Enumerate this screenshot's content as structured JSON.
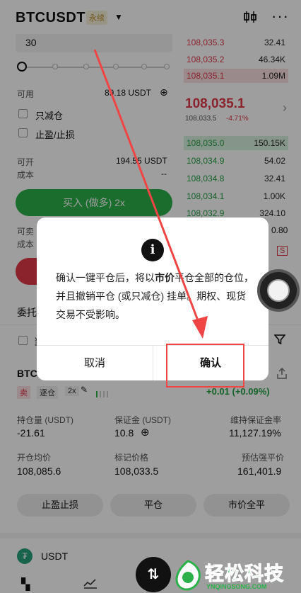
{
  "header": {
    "pair": "BTCUSDT",
    "contract_tag": "永续",
    "chart_icon": "candlestick-icon",
    "more_icon": "more-icon"
  },
  "order_form": {
    "input_value": "30",
    "available_label": "可用",
    "available_value": "89.18 USDT",
    "reduce_only_label": "只减仓",
    "tp_sl_label": "止盈/止损",
    "can_open_label": "可开",
    "can_open_value": "194.55 USDT",
    "cost_label": "成本",
    "cost_value": "--",
    "buy_button": "买入 (做多) 2x",
    "can_sell_label": "可卖",
    "cost_label2": "成本"
  },
  "orderbook": {
    "asks": [
      {
        "price": "108,035.3",
        "qty": "32.41"
      },
      {
        "price": "108,035.2",
        "qty": "46.34K"
      },
      {
        "price": "108,035.1",
        "qty": "1.09M"
      }
    ],
    "last_price": "108,035.1",
    "mark_price": "108,033.5",
    "change": "-4.71%",
    "bids": [
      {
        "price": "108,035.0",
        "qty": "150.15K"
      },
      {
        "price": "108,034.9",
        "qty": "54.02"
      },
      {
        "price": "108,034.8",
        "qty": "32.41"
      },
      {
        "price": "108,034.1",
        "qty": "1.00K"
      },
      {
        "price": "108,032.9",
        "qty": "324.10"
      }
    ],
    "partial_qty": "0.80",
    "ratio_marker": "S"
  },
  "orders_section": {
    "title": "委托",
    "checkbox_partial": "当"
  },
  "position": {
    "symbol": "BTC",
    "side": "卖",
    "margin_mode": "逐仓",
    "leverage": "2x",
    "pnl": "+0.01 (+0.09%)",
    "size_label": "持仓量 (USDT)",
    "size_value": "-21.61",
    "margin_label": "保证金 (USDT)",
    "margin_value": "10.8",
    "maint_label": "维持保证金率",
    "maint_value": "11,127.19%",
    "entry_label": "开仓均价",
    "entry_value": "108,085.6",
    "mark_label": "标记价格",
    "mark_value": "108,033.5",
    "liq_label": "预估强平价",
    "liq_value": "161,401.9",
    "btn_tpsl": "止盈止损",
    "btn_close": "平仓",
    "btn_market_close": "市价全平"
  },
  "asset": {
    "currency": "USDT"
  },
  "dialog": {
    "icon": "info-icon",
    "text_part1": "确认一键平仓后，将以",
    "text_bold": "市价",
    "text_part2": "平仓全部的仓位，并且撤销平仓 (或只减仓) 挂单。期权、现货交易不受影响。",
    "cancel": "取消",
    "confirm": "确认"
  },
  "watermark": {
    "title": "轻松科技",
    "url": "YNQINGSONG.COM"
  },
  "colors": {
    "buy_green": "#2bb04a",
    "sell_red": "#e0394a",
    "annotation_red": "#f04545"
  }
}
